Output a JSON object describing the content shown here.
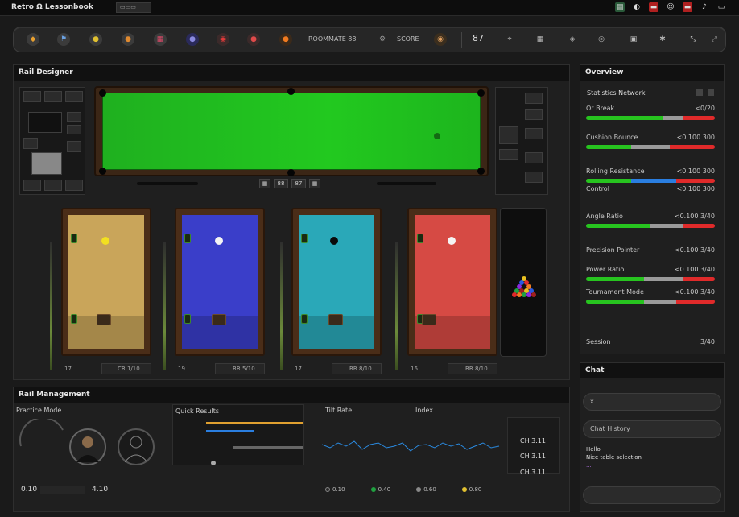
{
  "titlebar": {
    "app_title": "Retro Ω Lessonbook",
    "title_field": "▭▭▭",
    "tray_icons": [
      "network-icon",
      "shield-icon",
      "flag-icon",
      "users-icon",
      "flag-icon",
      "sound-icon",
      "window-icon"
    ]
  },
  "toolbar": {
    "tools": [
      "break-icon",
      "cue-icon",
      "chalk-icon",
      "ball-icon",
      "rack-icon",
      "planet-icon",
      "target-icon",
      "ball-red-icon",
      "ball-orange-icon"
    ],
    "label_a": "ROOMMATE 88",
    "label_b": "SCORE",
    "label_c": "87",
    "right_tools": [
      "pin-icon",
      "grid-icon",
      "cube-icon",
      "star-icon",
      "arrows-icon"
    ]
  },
  "main_panel": {
    "title": "Rail Designer",
    "score_a": "88",
    "score_b": "87"
  },
  "tables": [
    {
      "color": "#c9a55a",
      "footer_label": "17",
      "footer_value": "CR 1/10"
    },
    {
      "color": "#3a3ec9",
      "footer_label": "19",
      "footer_value": "RR 5/10"
    },
    {
      "color": "#2aa8b8",
      "footer_label": "17",
      "footer_value": "RR 8/10"
    },
    {
      "color": "#d64a44",
      "footer_label": "16",
      "footer_value": "RR 8/10"
    }
  ],
  "sidebar": {
    "title": "Overview",
    "subtitle": "Statistics Network",
    "rows": [
      {
        "label": "Or Break",
        "value": "<0/20"
      },
      {
        "label": "Cushion Bounce",
        "value": "<0.100 300"
      },
      {
        "label": "Rolling Resistance",
        "value": "<0.100 300"
      },
      {
        "label": "Control",
        "value": "<0.100 300"
      },
      {
        "label": "Angle Ratio",
        "value": "<0.100 3/40"
      },
      {
        "label": "Precision Pointer",
        "value": "<0.100 3/40"
      },
      {
        "label": "Power Ratio",
        "value": "<0.100 3/40"
      },
      {
        "label": "Tournament Mode",
        "value": "<0.100 3/40"
      }
    ],
    "final_label": "Session",
    "final_value": "3/40"
  },
  "chat": {
    "title": "Chat",
    "input_1": "x",
    "input_2": "Chat History",
    "lines": [
      "Hello",
      "Nice table selection",
      "..."
    ],
    "input_3": ""
  },
  "bottom_panel": {
    "title": "Rail Management",
    "section_1": "Practice Mode",
    "section_2": "Quick Results",
    "section_3": "Tilt Rate",
    "section_4": "Index",
    "footer_left": "0.10",
    "footer_right": "4.10",
    "legend": [
      "0.10",
      "0.40",
      "0.60",
      "0.80"
    ],
    "readouts": [
      "CH 3.11",
      "CH 3.11",
      "CH 3.11"
    ]
  },
  "colors": {
    "green": "#27c41f",
    "red": "#e02a2a",
    "grey": "#9a9a9a",
    "blue": "#2a7ee0"
  }
}
